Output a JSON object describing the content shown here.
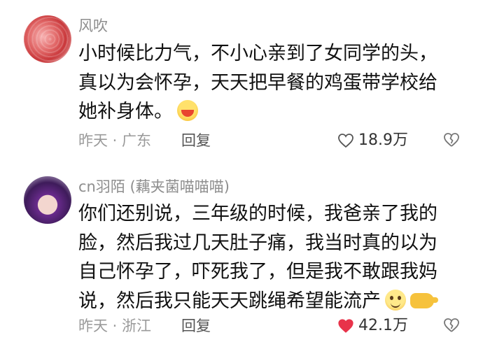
{
  "comments": [
    {
      "username": "风吹",
      "lines": [
        "小时候比力气，不小心亲到了女同学的头，",
        "真以为会怀孕，天天把早餐的鸡蛋带学校给",
        "她补身体。"
      ],
      "emojis": [
        "crying-laughing-emoji"
      ],
      "meta": "昨天 · 广东",
      "reply_label": "回复",
      "likes": "18.9万",
      "liked": false
    },
    {
      "username": "cn羽陌 (藕夹菌喵喵喵)",
      "lines": [
        "你们还别说，三年级的时候，我爸亲了我的",
        "脸，然后我过几天肚子痛，我当时真的以为",
        "自己怀孕了，吓死我了，但是我不敢跟我妈",
        "说，然后我只能天天跳绳希望能流产"
      ],
      "emojis": [
        "smiling-face-emoji",
        "pointing-hand-emoji"
      ],
      "meta": "昨天 · 浙江",
      "reply_label": "回复",
      "likes": "42.1万",
      "liked": true
    }
  ],
  "colors": {
    "liked_heart": "#e8334a",
    "muted_text": "#9a9a9a"
  }
}
